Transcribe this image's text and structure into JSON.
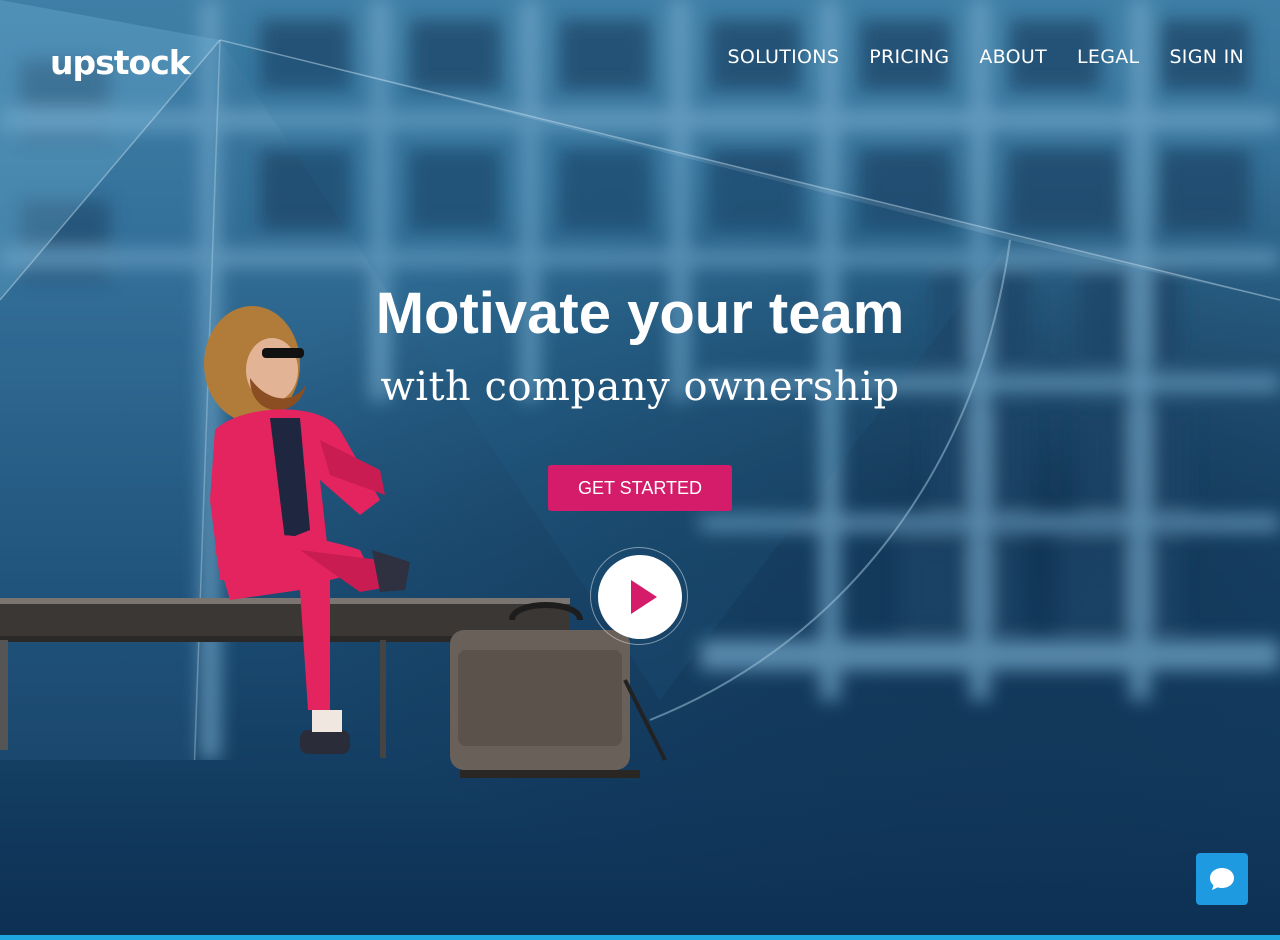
{
  "brand": {
    "logo_text": "upstock"
  },
  "nav": {
    "links": [
      {
        "label": "SOLUTIONS"
      },
      {
        "label": "PRICING"
      },
      {
        "label": "ABOUT"
      },
      {
        "label": "LEGAL"
      },
      {
        "label": "SIGN IN"
      }
    ]
  },
  "hero": {
    "title": "Motivate your team",
    "subtitle": "with company ownership",
    "cta_label": "GET STARTED"
  },
  "icons": {
    "play": "play-icon",
    "chat": "chat-bubble-icon"
  },
  "colors": {
    "accent": "#d41c6a",
    "chat": "#1e9ae0",
    "text": "#ffffff"
  }
}
